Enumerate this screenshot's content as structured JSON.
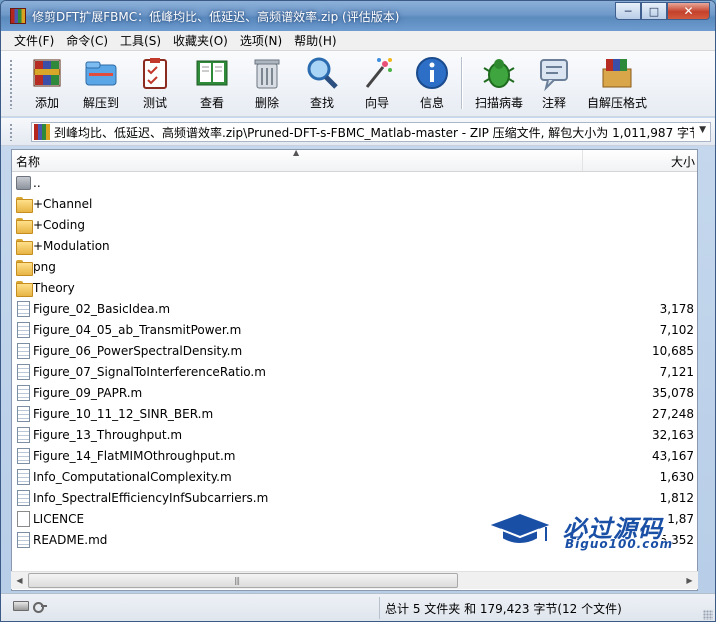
{
  "window": {
    "title": "修剪DFT扩展FBMC：低峰均比、低延迟、高频谱效率.zip (评估版本)",
    "controls": {
      "minimize": "─",
      "maximize": "□",
      "close": "✕"
    }
  },
  "menu": [
    "文件(F)",
    "命令(C)",
    "工具(S)",
    "收藏夹(O)",
    "选项(N)",
    "帮助(H)"
  ],
  "toolbar": [
    {
      "label": "添加",
      "icon": "add-archive-icon"
    },
    {
      "label": "解压到",
      "icon": "extract-to-icon"
    },
    {
      "label": "测试",
      "icon": "test-icon"
    },
    {
      "label": "查看",
      "icon": "view-book-icon"
    },
    {
      "label": "删除",
      "icon": "trash-icon"
    },
    {
      "label": "查找",
      "icon": "magnifier-icon"
    },
    {
      "label": "向导",
      "icon": "wizard-wand-icon"
    },
    {
      "label": "信息",
      "icon": "info-icon"
    },
    {
      "label": "扫描病毒",
      "icon": "virus-scan-icon"
    },
    {
      "label": "注释",
      "icon": "comment-icon"
    },
    {
      "label": "自解压格式",
      "icon": "sfx-icon"
    }
  ],
  "address": {
    "path": "刭峰均比、低延迟、高频谱效率.zip\\Pruned-DFT-s-FBMC_Matlab-master - ZIP 压缩文件, 解包大小为 1,011,987 字节",
    "dropdown": "▼"
  },
  "columns": {
    "name": "名称",
    "size": "大小",
    "sort_indicator": "▲"
  },
  "files": [
    {
      "name": "..",
      "size": "",
      "type": "up"
    },
    {
      "name": "+Channel",
      "size": "",
      "type": "folder"
    },
    {
      "name": "+Coding",
      "size": "",
      "type": "folder"
    },
    {
      "name": "+Modulation",
      "size": "",
      "type": "folder"
    },
    {
      "name": "png",
      "size": "",
      "type": "folder"
    },
    {
      "name": "Theory",
      "size": "",
      "type": "folder"
    },
    {
      "name": "Figure_02_BasicIdea.m",
      "size": "3,178",
      "type": "m-file"
    },
    {
      "name": "Figure_04_05_ab_TransmitPower.m",
      "size": "7,102",
      "type": "m-file"
    },
    {
      "name": "Figure_06_PowerSpectralDensity.m",
      "size": "10,685",
      "type": "m-file"
    },
    {
      "name": "Figure_07_SignalToInterferenceRatio.m",
      "size": "7,121",
      "type": "m-file"
    },
    {
      "name": "Figure_09_PAPR.m",
      "size": "35,078",
      "type": "m-file"
    },
    {
      "name": "Figure_10_11_12_SINR_BER.m",
      "size": "27,248",
      "type": "m-file"
    },
    {
      "name": "Figure_13_Throughput.m",
      "size": "32,163",
      "type": "m-file"
    },
    {
      "name": "Figure_14_FlatMIMOthroughput.m",
      "size": "43,167",
      "type": "m-file"
    },
    {
      "name": "Info_ComputationalComplexity.m",
      "size": "1,630",
      "type": "m-file"
    },
    {
      "name": "Info_SpectralEfficiencyInfSubcarriers.m",
      "size": "1,812",
      "type": "m-file"
    },
    {
      "name": "LICENCE",
      "size": "1,87",
      "type": "blank"
    },
    {
      "name": "README.md",
      "size": "5,352",
      "type": "m-file"
    }
  ],
  "scrollbar": {
    "left": "◀",
    "right": "▶",
    "grip": "|||"
  },
  "status": {
    "text": "总计 5 文件夹 和 179,423 字节(12 个文件)"
  },
  "watermark": {
    "title": "必过源码",
    "url": "Biguo100.com"
  }
}
